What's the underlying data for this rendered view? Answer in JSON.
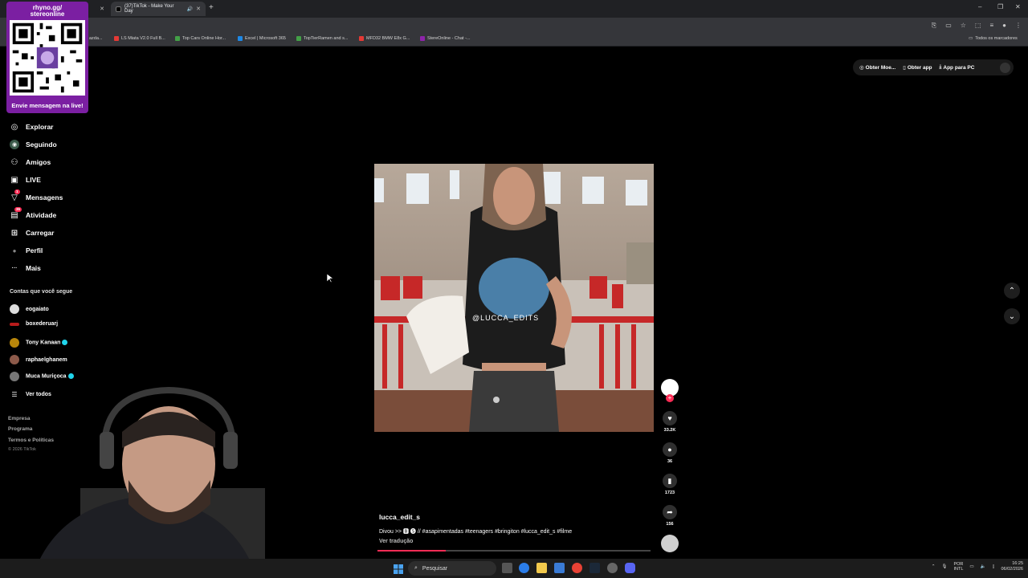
{
  "browser": {
    "tabs": [
      {
        "label": ""
      },
      {
        "label": "(37)TikTok - Make Your Day"
      }
    ],
    "bookmarks": [
      {
        "label": "azda...",
        "color": "#444"
      },
      {
        "label": "LS Miata V2.0 Full B...",
        "color": "#e53935"
      },
      {
        "label": "Top Cars Online Hor...",
        "color": "#43a047"
      },
      {
        "label": "Excel | Microsoft 365",
        "color": "#1e88e5"
      },
      {
        "label": "TopTierRamen and s...",
        "color": "#43a047"
      },
      {
        "label": "MFD32 BMW E8x G...",
        "color": "#e53935"
      },
      {
        "label": "StereOnline - Chat -...",
        "color": "#8e24aa"
      }
    ],
    "all_bookmarks_label": "Todos os marcadores"
  },
  "qr": {
    "title_line1": "rhyno.gg/",
    "title_line2": "stereonline",
    "cta": "Envie mensagem na live!",
    "color": "#7b1fa2"
  },
  "sidebar": {
    "items": [
      {
        "label": "Explorar",
        "icon": "compass-icon",
        "glyph": "◎"
      },
      {
        "label": "Seguindo",
        "icon": "following-icon",
        "glyph": "◉"
      },
      {
        "label": "Amigos",
        "icon": "friends-icon",
        "glyph": "⚇"
      },
      {
        "label": "LIVE",
        "icon": "live-icon",
        "glyph": "▣"
      },
      {
        "label": "Mensagens",
        "icon": "messages-icon",
        "glyph": "▽",
        "badge": "1"
      },
      {
        "label": "Atividade",
        "icon": "activity-icon",
        "glyph": "▤",
        "badge": "36"
      },
      {
        "label": "Carregar",
        "icon": "upload-icon",
        "glyph": "⊞"
      },
      {
        "label": "Perfil",
        "icon": "profile-icon",
        "glyph": "●"
      },
      {
        "label": "Mais",
        "icon": "more-icon",
        "glyph": "···"
      }
    ],
    "following_title": "Contas que você segue",
    "following": [
      {
        "name": "eogaiato",
        "verified": false
      },
      {
        "name": "boxederuarj",
        "verified": false
      },
      {
        "name": "Tony Kanaan",
        "verified": true
      },
      {
        "name": "raphaelghanem",
        "verified": false
      },
      {
        "name": "Muca Muriçoca",
        "verified": true
      }
    ],
    "see_all": "Ver todos",
    "footer": [
      "Empresa",
      "Programa",
      "Termos e Políticas"
    ],
    "copyright": "© 2026 TikTok"
  },
  "top_actions": {
    "get_coins": "Obter Moe...",
    "get_app": "Obter app",
    "pc_app": "App para PC"
  },
  "video": {
    "overlay_handle": "@LUCCA_EDITS",
    "author": "lucca_edit_s",
    "caption": "Divou >> 🅱 🅢 // #asapimentadas #teenagers #bringiton #lucca_edit_s #filme",
    "translate": "Ver tradução",
    "progress": 0.25
  },
  "actions": {
    "likes": "33.2K",
    "comments": "36",
    "saves": "1723",
    "shares": "156"
  },
  "taskbar": {
    "search_placeholder": "Pesquisar",
    "lang_line1": "POR",
    "lang_line2": "INTL",
    "time": "16:25",
    "date": "06/02/2026"
  },
  "colors": {
    "accent": "#fe2c55",
    "verified": "#20d5ec"
  }
}
